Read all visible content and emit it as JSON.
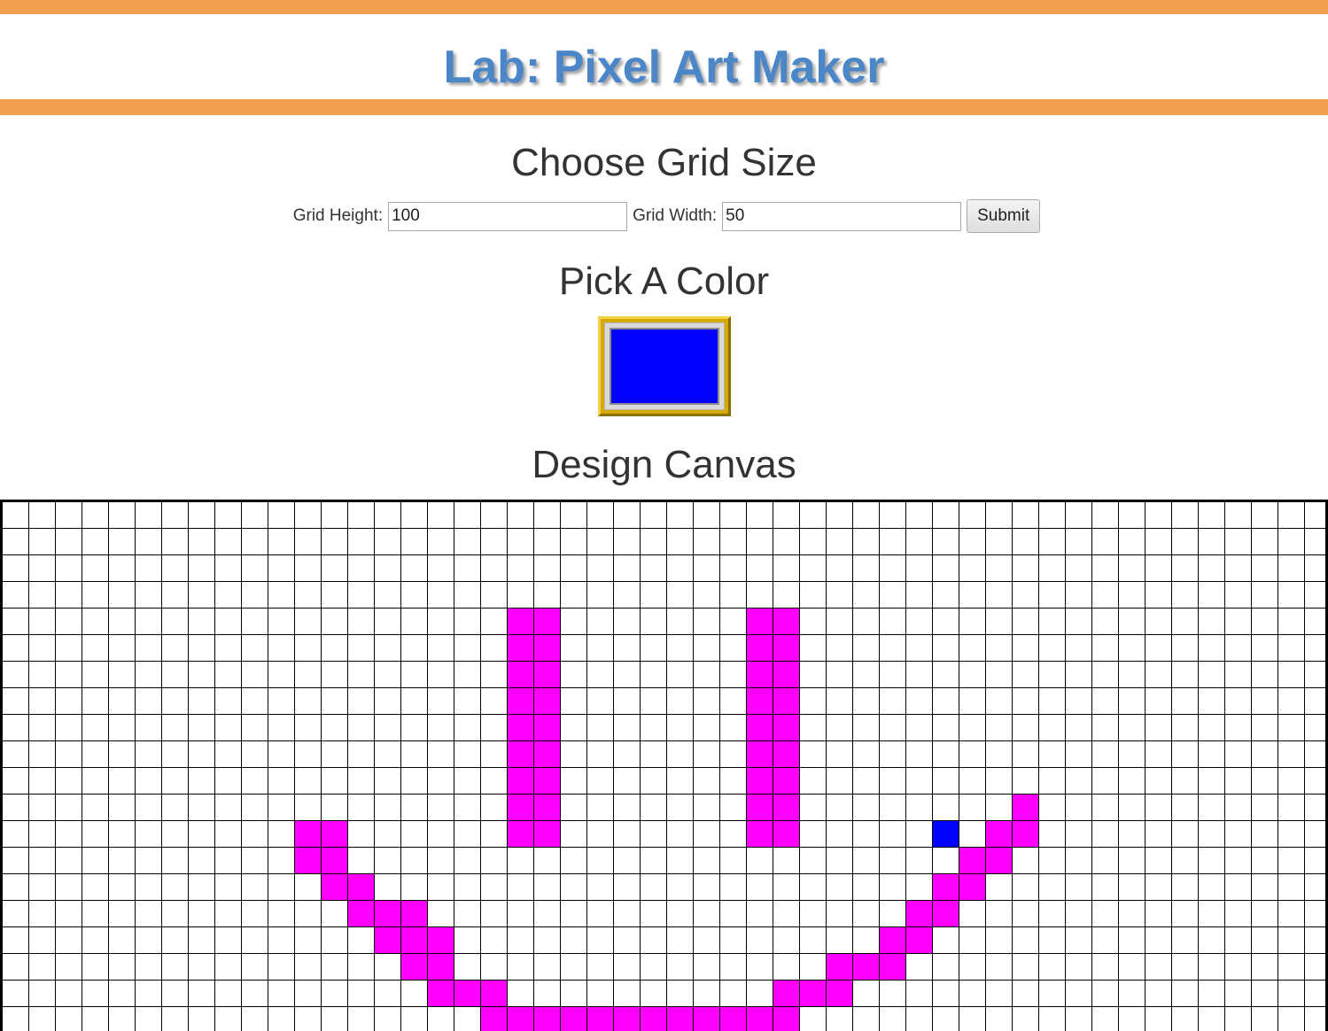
{
  "header": {
    "title": "Lab: Pixel Art Maker"
  },
  "grid_size": {
    "heading": "Choose Grid Size",
    "height_label": "Grid Height:",
    "height_value": "100",
    "width_label": "Grid Width:",
    "width_value": "50",
    "submit_label": "Submit"
  },
  "color": {
    "heading": "Pick A Color",
    "selected": "#0000ff"
  },
  "canvas": {
    "heading": "Design Canvas",
    "visible_columns": 50,
    "visible_rows": 20,
    "painted_cells": [
      {
        "row": 4,
        "col": 19,
        "color": "#ff00ff"
      },
      {
        "row": 4,
        "col": 20,
        "color": "#ff00ff"
      },
      {
        "row": 4,
        "col": 28,
        "color": "#ff00ff"
      },
      {
        "row": 4,
        "col": 29,
        "color": "#ff00ff"
      },
      {
        "row": 5,
        "col": 19,
        "color": "#ff00ff"
      },
      {
        "row": 5,
        "col": 20,
        "color": "#ff00ff"
      },
      {
        "row": 5,
        "col": 28,
        "color": "#ff00ff"
      },
      {
        "row": 5,
        "col": 29,
        "color": "#ff00ff"
      },
      {
        "row": 6,
        "col": 19,
        "color": "#ff00ff"
      },
      {
        "row": 6,
        "col": 20,
        "color": "#ff00ff"
      },
      {
        "row": 6,
        "col": 28,
        "color": "#ff00ff"
      },
      {
        "row": 6,
        "col": 29,
        "color": "#ff00ff"
      },
      {
        "row": 7,
        "col": 19,
        "color": "#ff00ff"
      },
      {
        "row": 7,
        "col": 20,
        "color": "#ff00ff"
      },
      {
        "row": 7,
        "col": 28,
        "color": "#ff00ff"
      },
      {
        "row": 7,
        "col": 29,
        "color": "#ff00ff"
      },
      {
        "row": 8,
        "col": 19,
        "color": "#ff00ff"
      },
      {
        "row": 8,
        "col": 20,
        "color": "#ff00ff"
      },
      {
        "row": 8,
        "col": 28,
        "color": "#ff00ff"
      },
      {
        "row": 8,
        "col": 29,
        "color": "#ff00ff"
      },
      {
        "row": 9,
        "col": 19,
        "color": "#ff00ff"
      },
      {
        "row": 9,
        "col": 20,
        "color": "#ff00ff"
      },
      {
        "row": 9,
        "col": 28,
        "color": "#ff00ff"
      },
      {
        "row": 9,
        "col": 29,
        "color": "#ff00ff"
      },
      {
        "row": 10,
        "col": 19,
        "color": "#ff00ff"
      },
      {
        "row": 10,
        "col": 20,
        "color": "#ff00ff"
      },
      {
        "row": 10,
        "col": 28,
        "color": "#ff00ff"
      },
      {
        "row": 10,
        "col": 29,
        "color": "#ff00ff"
      },
      {
        "row": 11,
        "col": 19,
        "color": "#ff00ff"
      },
      {
        "row": 11,
        "col": 20,
        "color": "#ff00ff"
      },
      {
        "row": 11,
        "col": 28,
        "color": "#ff00ff"
      },
      {
        "row": 11,
        "col": 29,
        "color": "#ff00ff"
      },
      {
        "row": 12,
        "col": 19,
        "color": "#ff00ff"
      },
      {
        "row": 12,
        "col": 20,
        "color": "#ff00ff"
      },
      {
        "row": 12,
        "col": 28,
        "color": "#ff00ff"
      },
      {
        "row": 12,
        "col": 29,
        "color": "#ff00ff"
      },
      {
        "row": 11,
        "col": 38,
        "color": "#ff00ff"
      },
      {
        "row": 12,
        "col": 11,
        "color": "#ff00ff"
      },
      {
        "row": 12,
        "col": 12,
        "color": "#ff00ff"
      },
      {
        "row": 12,
        "col": 35,
        "color": "#0000ff"
      },
      {
        "row": 12,
        "col": 37,
        "color": "#ff00ff"
      },
      {
        "row": 12,
        "col": 38,
        "color": "#ff00ff"
      },
      {
        "row": 13,
        "col": 11,
        "color": "#ff00ff"
      },
      {
        "row": 13,
        "col": 12,
        "color": "#ff00ff"
      },
      {
        "row": 13,
        "col": 36,
        "color": "#ff00ff"
      },
      {
        "row": 13,
        "col": 37,
        "color": "#ff00ff"
      },
      {
        "row": 14,
        "col": 12,
        "color": "#ff00ff"
      },
      {
        "row": 14,
        "col": 13,
        "color": "#ff00ff"
      },
      {
        "row": 14,
        "col": 35,
        "color": "#ff00ff"
      },
      {
        "row": 14,
        "col": 36,
        "color": "#ff00ff"
      },
      {
        "row": 15,
        "col": 13,
        "color": "#ff00ff"
      },
      {
        "row": 15,
        "col": 14,
        "color": "#ff00ff"
      },
      {
        "row": 15,
        "col": 15,
        "color": "#ff00ff"
      },
      {
        "row": 15,
        "col": 34,
        "color": "#ff00ff"
      },
      {
        "row": 15,
        "col": 35,
        "color": "#ff00ff"
      },
      {
        "row": 16,
        "col": 14,
        "color": "#ff00ff"
      },
      {
        "row": 16,
        "col": 15,
        "color": "#ff00ff"
      },
      {
        "row": 16,
        "col": 16,
        "color": "#ff00ff"
      },
      {
        "row": 16,
        "col": 33,
        "color": "#ff00ff"
      },
      {
        "row": 16,
        "col": 34,
        "color": "#ff00ff"
      },
      {
        "row": 17,
        "col": 15,
        "color": "#ff00ff"
      },
      {
        "row": 17,
        "col": 16,
        "color": "#ff00ff"
      },
      {
        "row": 17,
        "col": 31,
        "color": "#ff00ff"
      },
      {
        "row": 17,
        "col": 32,
        "color": "#ff00ff"
      },
      {
        "row": 17,
        "col": 33,
        "color": "#ff00ff"
      },
      {
        "row": 18,
        "col": 16,
        "color": "#ff00ff"
      },
      {
        "row": 18,
        "col": 17,
        "color": "#ff00ff"
      },
      {
        "row": 18,
        "col": 18,
        "color": "#ff00ff"
      },
      {
        "row": 18,
        "col": 29,
        "color": "#ff00ff"
      },
      {
        "row": 18,
        "col": 30,
        "color": "#ff00ff"
      },
      {
        "row": 18,
        "col": 31,
        "color": "#ff00ff"
      },
      {
        "row": 19,
        "col": 18,
        "color": "#ff00ff"
      },
      {
        "row": 19,
        "col": 19,
        "color": "#ff00ff"
      },
      {
        "row": 19,
        "col": 20,
        "color": "#ff00ff"
      },
      {
        "row": 19,
        "col": 21,
        "color": "#ff00ff"
      },
      {
        "row": 19,
        "col": 22,
        "color": "#ff00ff"
      },
      {
        "row": 19,
        "col": 23,
        "color": "#ff00ff"
      },
      {
        "row": 19,
        "col": 24,
        "color": "#ff00ff"
      },
      {
        "row": 19,
        "col": 25,
        "color": "#ff00ff"
      },
      {
        "row": 19,
        "col": 26,
        "color": "#ff00ff"
      },
      {
        "row": 19,
        "col": 27,
        "color": "#ff00ff"
      },
      {
        "row": 19,
        "col": 28,
        "color": "#ff00ff"
      },
      {
        "row": 19,
        "col": 29,
        "color": "#ff00ff"
      }
    ]
  }
}
